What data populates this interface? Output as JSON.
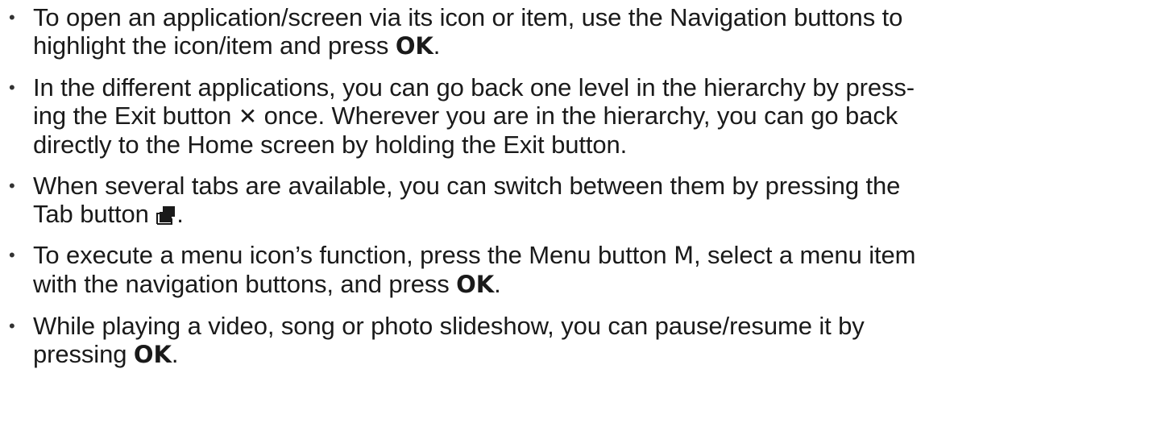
{
  "bullet_char": "•",
  "items": [
    {
      "lines": [
        {
          "text": "To open an application/screen via its icon or item, use the Navigation buttons to"
        },
        {
          "text": "highlight the icon/item and press ",
          "key": "OK",
          "after": "."
        }
      ]
    },
    {
      "lines": [
        {
          "text": "In the different applications, you can go back one level in the hierarchy by press-"
        },
        {
          "text": "ing the Exit button ",
          "icon": "✕",
          "after": " once. Wherever you are in the hierarchy, you can go back"
        },
        {
          "text": "directly to the Home screen by holding the Exit button."
        }
      ]
    },
    {
      "lines": [
        {
          "text": "When several tabs are available, you can switch between them by pressing the"
        },
        {
          "text": "Tab button ",
          "after": "."
        }
      ],
      "icon_name": "tab-icon"
    },
    {
      "lines": [
        {
          "text": "To execute a menu icon’s function, press the Menu button ",
          "key": "M",
          "after": ", select a menu item"
        },
        {
          "text": "with the navigation buttons, and press ",
          "key": "OK",
          "after": "."
        }
      ]
    },
    {
      "lines": [
        {
          "text": "While playing a video, song or photo slideshow, you can pause/resume it by"
        },
        {
          "text": "pressing ",
          "key": "OK",
          "after": "."
        }
      ]
    }
  ]
}
